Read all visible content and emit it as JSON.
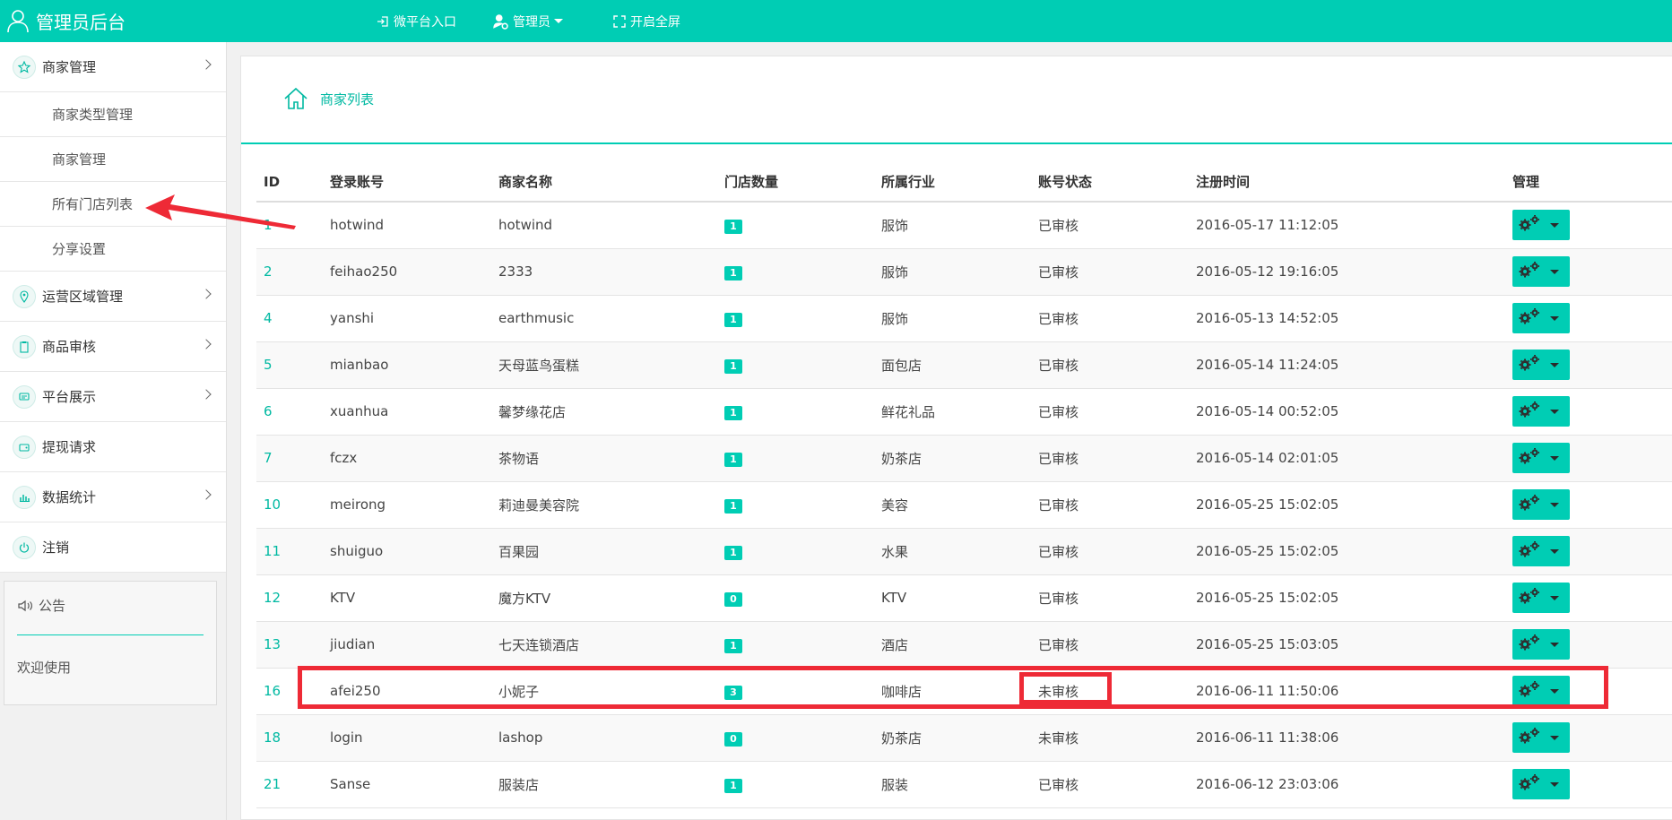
{
  "header": {
    "title": "管理员后台",
    "nav": [
      {
        "label": "微平台入口",
        "icon": "sign-in-icon"
      },
      {
        "label": "管理员",
        "icon": "user-cog-icon"
      },
      {
        "label": "开启全屏",
        "icon": "fullscreen-icon"
      }
    ]
  },
  "sidebar": {
    "merchant_mgmt": "商家管理",
    "sub_items": [
      "商家类型管理",
      "商家管理",
      "所有门店列表",
      "分享设置"
    ],
    "items": [
      {
        "label": "运营区域管理",
        "icon": "location-icon"
      },
      {
        "label": "商品审核",
        "icon": "clipboard-icon"
      },
      {
        "label": "平台展示",
        "icon": "display-icon"
      },
      {
        "label": "提现请求",
        "icon": "wallet-icon"
      },
      {
        "label": "数据统计",
        "icon": "bar-chart-icon"
      },
      {
        "label": "注销",
        "icon": "power-icon"
      }
    ],
    "notice": {
      "title": "公告",
      "body": "欢迎使用"
    }
  },
  "breadcrumb": {
    "label": "商家列表"
  },
  "table": {
    "headers": [
      "ID",
      "登录账号",
      "商家名称",
      "门店数量",
      "所属行业",
      "账号状态",
      "注册时间",
      "管理"
    ],
    "rows": [
      {
        "id": "1",
        "account": "hotwind",
        "name": "hotwind",
        "stores": "1",
        "industry": "服饰",
        "status": "已审核",
        "time": "2016-05-17 11:12:05"
      },
      {
        "id": "2",
        "account": "feihao250",
        "name": "2333",
        "stores": "1",
        "industry": "服饰",
        "status": "已审核",
        "time": "2016-05-12 19:16:05"
      },
      {
        "id": "4",
        "account": "yanshi",
        "name": "earthmusic",
        "stores": "1",
        "industry": "服饰",
        "status": "已审核",
        "time": "2016-05-13 14:52:05"
      },
      {
        "id": "5",
        "account": "mianbao",
        "name": "天母蓝鸟蛋糕",
        "stores": "1",
        "industry": "面包店",
        "status": "已审核",
        "time": "2016-05-14 11:24:05"
      },
      {
        "id": "6",
        "account": "xuanhua",
        "name": "馨梦缘花店",
        "stores": "1",
        "industry": "鲜花礼品",
        "status": "已审核",
        "time": "2016-05-14 00:52:05"
      },
      {
        "id": "7",
        "account": "fczx",
        "name": "茶物语",
        "stores": "1",
        "industry": "奶茶店",
        "status": "已审核",
        "time": "2016-05-14 02:01:05"
      },
      {
        "id": "10",
        "account": "meirong",
        "name": "莉迪曼美容院",
        "stores": "1",
        "industry": "美容",
        "status": "已审核",
        "time": "2016-05-25 15:02:05"
      },
      {
        "id": "11",
        "account": "shuiguo",
        "name": "百果园",
        "stores": "1",
        "industry": "水果",
        "status": "已审核",
        "time": "2016-05-25 15:02:05"
      },
      {
        "id": "12",
        "account": "KTV",
        "name": "魔方KTV",
        "stores": "0",
        "industry": "KTV",
        "status": "已审核",
        "time": "2016-05-25 15:02:05"
      },
      {
        "id": "13",
        "account": "jiudian",
        "name": "七天连锁酒店",
        "stores": "1",
        "industry": "酒店",
        "status": "已审核",
        "time": "2016-05-25 15:03:05"
      },
      {
        "id": "16",
        "account": "afei250",
        "name": "小妮子",
        "stores": "3",
        "industry": "咖啡店",
        "status": "未审核",
        "time": "2016-06-11 11:50:06"
      },
      {
        "id": "18",
        "account": "login",
        "name": "lashop",
        "stores": "0",
        "industry": "奶茶店",
        "status": "未审核",
        "time": "2016-06-11 11:38:06"
      },
      {
        "id": "21",
        "account": "Sanse",
        "name": "服装店",
        "stores": "1",
        "industry": "服装",
        "status": "已审核",
        "time": "2016-06-12 23:03:06"
      }
    ]
  },
  "colors": {
    "accent": "#00cdb4",
    "annotation": "#ee2a36"
  }
}
